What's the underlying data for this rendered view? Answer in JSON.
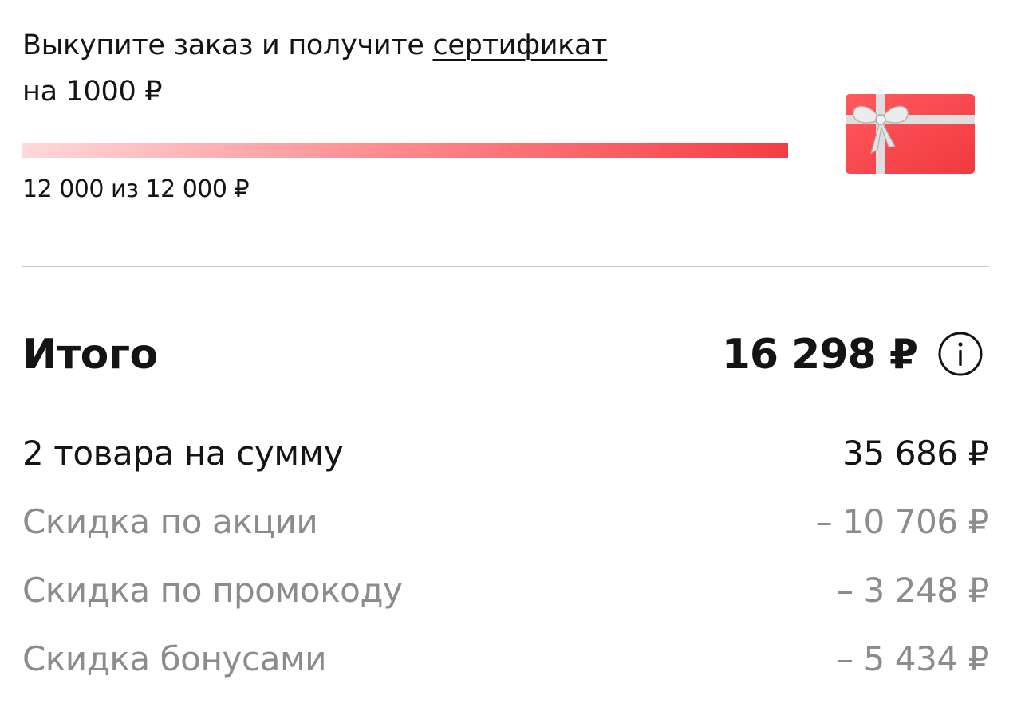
{
  "promo": {
    "text_before": "Выкупите заказ и получите ",
    "link_text": "сертификат",
    "text_after": "на 1000 ₽",
    "progress_text": "12 000 из 12 000 ₽",
    "progress_fraction": 1.0
  },
  "icons": {
    "gift_card": "gift-card-icon",
    "info": "info-icon"
  },
  "colors": {
    "accent": "#f43c42",
    "card": "#f8464a",
    "ribbon": "#d9d9d9",
    "text": "#141414",
    "muted": "#8c8c8c"
  },
  "summary": {
    "total_label": "Итого",
    "total_value": "16 298 ₽",
    "lines": [
      {
        "label": "2 товара на сумму",
        "value": "35 686 ₽"
      },
      {
        "label": "Скидка по акции",
        "value": "– 10 706 ₽"
      },
      {
        "label": "Скидка по промокоду",
        "value": "– 3 248 ₽"
      },
      {
        "label": "Скидка бонусами",
        "value": "– 5 434 ₽"
      }
    ]
  }
}
